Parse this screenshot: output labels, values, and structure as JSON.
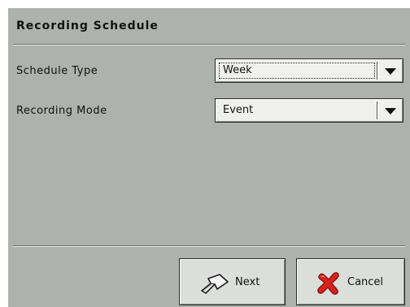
{
  "dialog": {
    "title": "Recording Schedule"
  },
  "fields": [
    {
      "label": "Schedule Type",
      "value": "Week"
    },
    {
      "label": "Recording Mode",
      "value": "Event"
    }
  ],
  "buttons": {
    "next_label": "Next",
    "cancel_label": "Cancel"
  },
  "icons": {
    "next": "next-arrow-icon",
    "cancel": "red-x-icon",
    "dropdown": "chevron-down-icon"
  },
  "colors": {
    "panel_background": "#aeb1ae",
    "cancel_icon": "#d8231c"
  }
}
